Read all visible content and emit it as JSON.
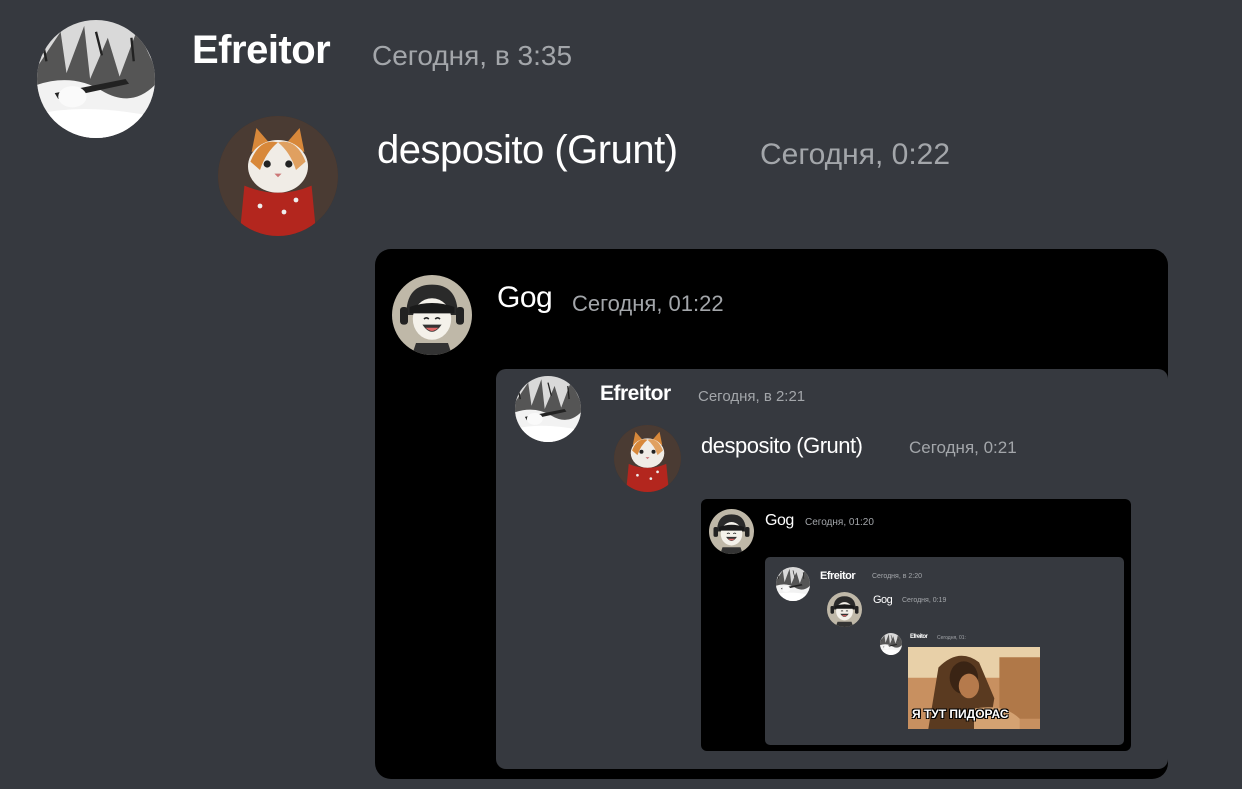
{
  "messages": [
    {
      "author": "Efreitor",
      "timestamp": "Сегодня, в 3:35",
      "avatar": "snow-soldier-avatar"
    },
    {
      "author": "desposito (Grunt)",
      "timestamp": "Сегодня, 0:22",
      "avatar": "cat-bandana-avatar"
    }
  ],
  "embed": {
    "level1": {
      "author": "Gog",
      "timestamp": "Сегодня, 01:22",
      "avatar": "laughing-helmet-avatar"
    },
    "level2": [
      {
        "author": "Efreitor",
        "timestamp": "Сегодня, в 2:21"
      },
      {
        "author": "desposito (Grunt)",
        "timestamp": "Сегодня, 0:21"
      }
    ],
    "level3": {
      "author": "Gog",
      "timestamp": "Сегодня, 01:20"
    },
    "level4": [
      {
        "author": "Efreitor",
        "timestamp": "Сегодня, в 2:20"
      },
      {
        "author": "Gog",
        "timestamp": "Сегодня, 0:19"
      }
    ],
    "level5": {
      "author": "Efreitor",
      "timestamp": "Сегодня, 01:"
    },
    "meme_caption": "Я ТУТ ПИДОРАС"
  },
  "colors": {
    "background": "#36393f",
    "embed_dark": "#000000",
    "embed_gray": "#36393f",
    "username": "#ffffff",
    "timestamp": "#a3a6aa"
  }
}
